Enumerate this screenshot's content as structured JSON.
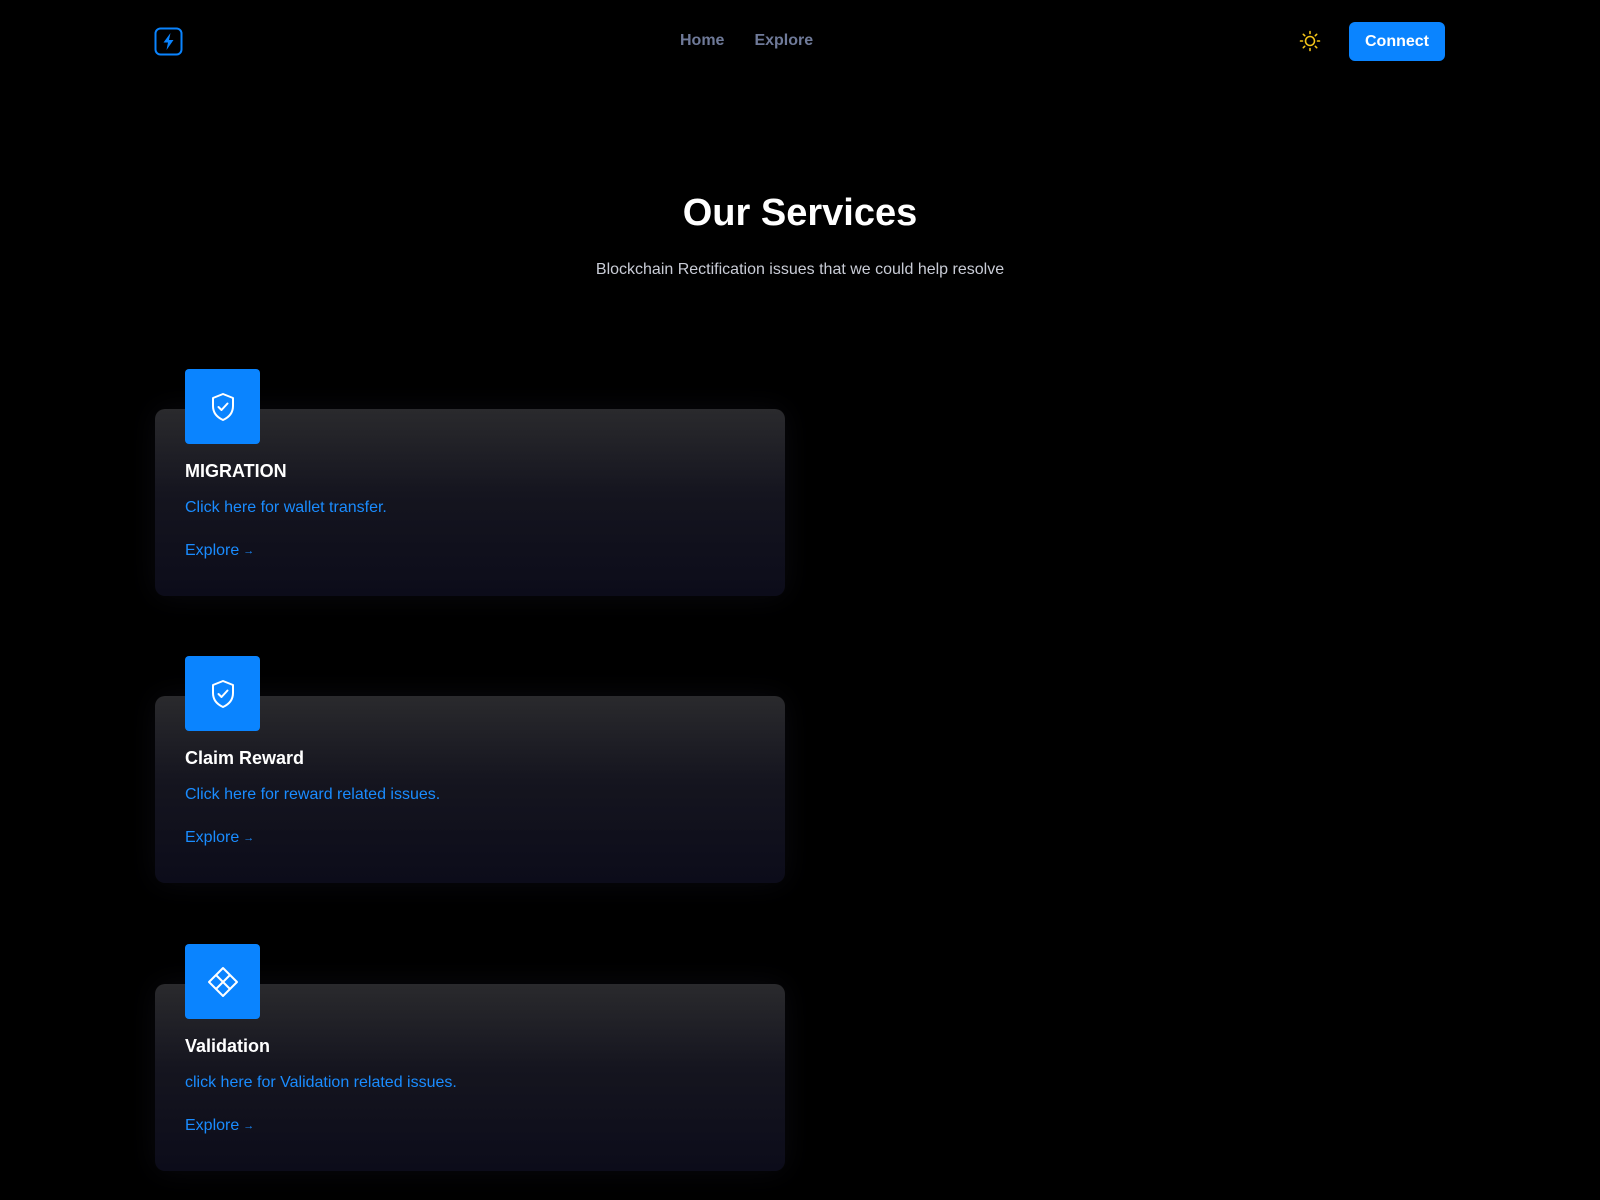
{
  "nav": {
    "logo_icon": "lightning-bolt-icon",
    "links": [
      "Home",
      "Explore"
    ],
    "theme_icon": "sun-icon",
    "connect_label": "Connect"
  },
  "hero": {
    "title": "Our Services",
    "subtitle": "Blockchain Rectification issues that we could help resolve"
  },
  "services": [
    {
      "icon": "shield-check-icon",
      "title": "MIGRATION",
      "description": "Click here for wallet transfer.",
      "explore_label": "Explore",
      "explore_arrow": "→"
    },
    {
      "icon": "shield-check-icon",
      "title": "Claim Reward",
      "description": "Click here for reward related issues.",
      "explore_label": "Explore",
      "explore_arrow": "→"
    },
    {
      "icon": "diamond-grid-icon",
      "title": "Validation",
      "description": "click here for Validation related issues.",
      "explore_label": "Explore",
      "explore_arrow": "→"
    }
  ],
  "colors": {
    "background": "#000000",
    "accent": "#0a84ff",
    "link": "#1a8cff",
    "nav_link": "#6f7a99",
    "sun": "#f5c518"
  }
}
